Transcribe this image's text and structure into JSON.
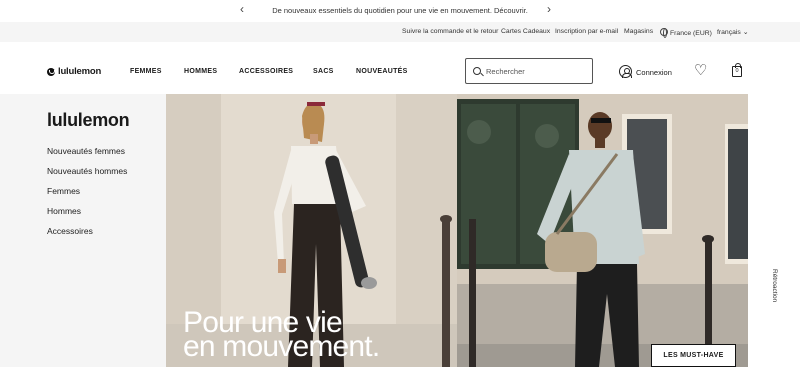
{
  "promo": {
    "text": "De nouveaux essentiels du quotidien pour une vie en mouvement. Découvrir.",
    "prev_icon": "‹",
    "next_icon": "›"
  },
  "utility": {
    "links": [
      "Suivre la commande et le retour",
      "Cartes Cadeaux",
      "Inscription par e-mail",
      "Magasins"
    ],
    "region": "France (EUR)",
    "language": "français"
  },
  "nav": {
    "logo": "lululemon",
    "links": [
      "FEMMES",
      "HOMMES",
      "ACCESSOIRES",
      "SACS",
      "NOUVEAUTÉS"
    ],
    "search_placeholder": "Rechercher",
    "login": "Connexion",
    "bag_count": "0"
  },
  "sidebar": {
    "logo": "lululemon",
    "items": [
      "Nouveautés femmes",
      "Nouveautés hommes",
      "Femmes",
      "Hommes",
      "Accessoires"
    ]
  },
  "hero": {
    "title_line1": "Pour une vie",
    "title_line2": "en mouvement.",
    "cta": "LES MUST-HAVE"
  },
  "feedback": "Rétroaction",
  "colors": {
    "text": "#1a1a1a",
    "sidebar_bg": "#f5f5f5",
    "utility_bg": "#f5f5f5"
  }
}
